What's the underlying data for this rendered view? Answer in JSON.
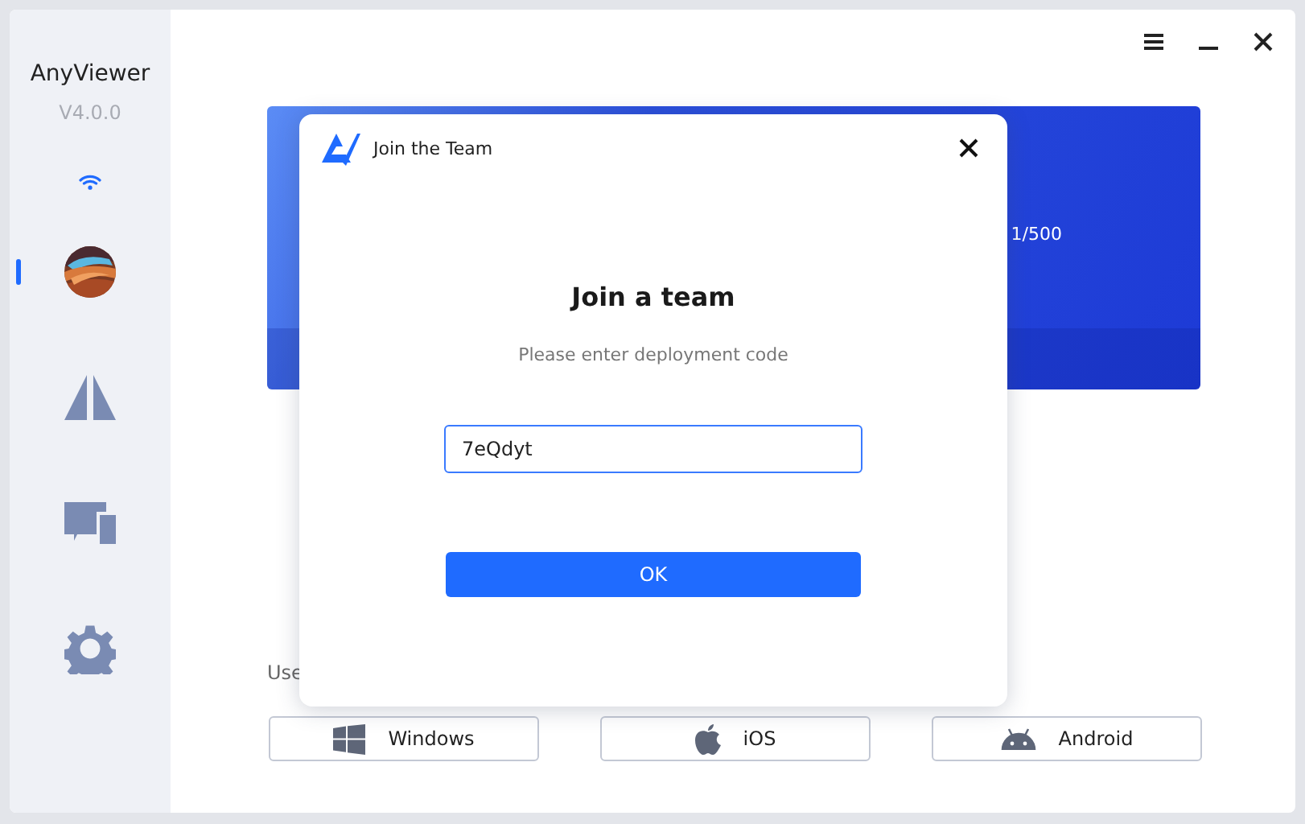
{
  "app": {
    "name": "AnyViewer",
    "version": "V4.0.0"
  },
  "sidebar": {
    "items": [
      {
        "kind": "avatar",
        "selected": true
      },
      {
        "kind": "remote",
        "selected": false
      },
      {
        "kind": "devices",
        "selected": false
      },
      {
        "kind": "settings",
        "selected": false
      }
    ]
  },
  "banner": {
    "count": "1/500"
  },
  "hint": "Use",
  "platforms": [
    {
      "kind": "windows",
      "label": "Windows"
    },
    {
      "kind": "ios",
      "label": "iOS"
    },
    {
      "kind": "android",
      "label": "Android"
    }
  ],
  "dialog": {
    "title": "Join the Team",
    "heading": "Join a team",
    "prompt": "Please enter deployment code",
    "code": "7eQdyt",
    "ok": "OK"
  }
}
